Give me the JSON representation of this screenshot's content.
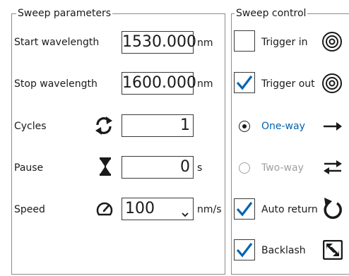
{
  "sweep_parameters": {
    "title": "Sweep parameters",
    "start_label": "Start wavelength",
    "start_value": "1530.000",
    "start_unit": "nm",
    "stop_label": "Stop wavelength",
    "stop_value": "1600.000",
    "stop_unit": "nm",
    "cycles_label": "Cycles",
    "cycles_value": "1",
    "pause_label": "Pause",
    "pause_value": "0",
    "pause_unit": "s",
    "speed_label": "Speed",
    "speed_value": "100",
    "speed_unit": "nm/s"
  },
  "sweep_control": {
    "title": "Sweep control",
    "trigger_in_label": "Trigger in",
    "trigger_in_checked": false,
    "trigger_out_label": "Trigger out",
    "trigger_out_checked": true,
    "one_way_label": "One-way",
    "one_way_selected": true,
    "two_way_label": "Two-way",
    "two_way_selected": false,
    "auto_return_label": "Auto return",
    "auto_return_checked": true,
    "backlash_label": "Backlash",
    "backlash_checked": true
  },
  "colors": {
    "accent": "#0063b1",
    "disabled": "#a0a0a0",
    "border": "#8c8c8c",
    "text": "#1a1a1a"
  },
  "icons": {
    "cycles": "cycle-arrows-icon",
    "pause": "hourglass-icon",
    "speed": "speedometer-icon",
    "trigger_in": "target-rings-icon",
    "trigger_out": "target-rings-icon",
    "one_way": "arrow-right-icon",
    "two_way": "arrows-left-right-icon",
    "auto_return": "return-arrow-icon",
    "backlash": "backlash-icon"
  }
}
